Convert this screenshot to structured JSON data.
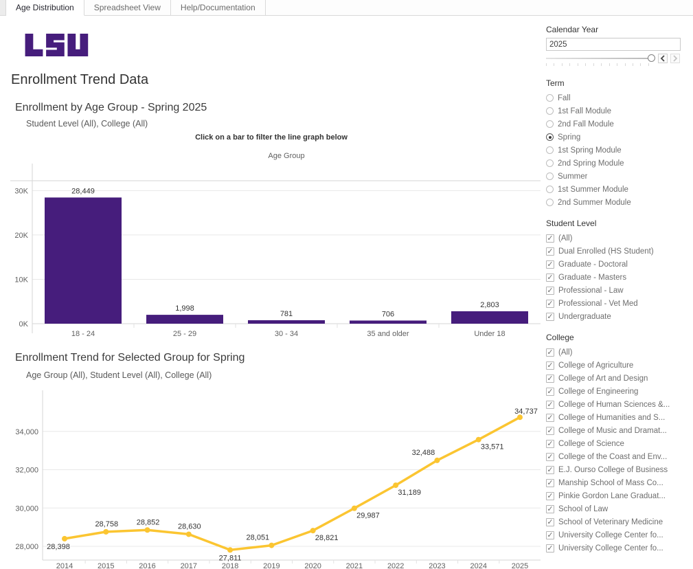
{
  "tabs": {
    "items": [
      {
        "label": "Age Distribution",
        "active": true
      },
      {
        "label": "Spreadsheet View",
        "active": false
      },
      {
        "label": "Help/Documentation",
        "active": false
      }
    ]
  },
  "header": {
    "logo": "LSU",
    "title": "Enrollment Trend Data"
  },
  "bar_section": {
    "title": "Enrollment by Age Group - Spring 2025",
    "subtitle": "Student Level (All), College (All)",
    "instruction": "Click on a bar to filter the line graph below",
    "column_header": "Age Group"
  },
  "line_section": {
    "title": "Enrollment Trend for Selected Group for Spring",
    "subtitle": "Age Group (All), Student Level (All), College (All)"
  },
  "colors": {
    "purple": "#461D7C",
    "gold": "#FBC531",
    "grid": "#e8e8e8",
    "axis": "#d6d6d6"
  },
  "chart_data": [
    {
      "type": "bar",
      "title": "Enrollment by Age Group - Spring 2025",
      "xlabel": "Age Group",
      "categories": [
        "18 - 24",
        "25 - 29",
        "30 - 34",
        "35 and older",
        "Under 18"
      ],
      "values": [
        28449,
        1998,
        781,
        706,
        2803
      ],
      "value_labels": [
        "28,449",
        "1,998",
        "781",
        "706",
        "2,803"
      ],
      "yticks": [
        0,
        10000,
        20000,
        30000
      ],
      "ytick_labels": [
        "0K",
        "10K",
        "20K",
        "30K"
      ],
      "ylim": [
        0,
        32230
      ],
      "grid": true,
      "bar_color": "#461D7C"
    },
    {
      "type": "line",
      "title": "Enrollment Trend for Selected Group for Spring",
      "x": [
        2014,
        2015,
        2016,
        2017,
        2018,
        2019,
        2020,
        2021,
        2022,
        2023,
        2024,
        2025
      ],
      "values": [
        28398,
        28758,
        28852,
        28630,
        27811,
        28051,
        28821,
        29987,
        31189,
        32488,
        33571,
        34737
      ],
      "value_labels": [
        "28,398",
        "28,758",
        "28,852",
        "28,630",
        "27,811",
        "28,051",
        "28,821",
        "29,987",
        "31,189",
        "32,488",
        "33,571",
        "34,737"
      ],
      "yticks": [
        28000,
        30000,
        32000,
        34000
      ],
      "ytick_labels": [
        "28,000",
        "30,000",
        "32,000",
        "34,000"
      ],
      "ylim": [
        27280,
        35320
      ],
      "grid": true,
      "line_color": "#FBC531",
      "label_placement": [
        "below-left",
        "above",
        "above",
        "above",
        "below",
        "above-left",
        "below-right",
        "below-right",
        "below-right",
        "above-left",
        "below-right",
        "above-right"
      ]
    }
  ],
  "filters": {
    "calendar_year": {
      "label": "Calendar Year",
      "value": "2025"
    },
    "term": {
      "label": "Term",
      "selected": "Spring",
      "options": [
        "Fall",
        "1st Fall Module",
        "2nd Fall Module",
        "Spring",
        "1st Spring Module",
        "2nd Spring Module",
        "Summer",
        "1st Summer Module",
        "2nd Summer Module"
      ]
    },
    "student_level": {
      "label": "Student Level",
      "options": [
        {
          "label": "(All)",
          "checked": true
        },
        {
          "label": "Dual Enrolled (HS Student)",
          "checked": true
        },
        {
          "label": "Graduate - Doctoral",
          "checked": true
        },
        {
          "label": "Graduate - Masters",
          "checked": true
        },
        {
          "label": "Professional - Law",
          "checked": true
        },
        {
          "label": "Professional - Vet Med",
          "checked": true
        },
        {
          "label": "Undergraduate",
          "checked": true
        }
      ]
    },
    "college": {
      "label": "College",
      "options": [
        {
          "label": "(All)",
          "checked": true
        },
        {
          "label": "College of Agriculture",
          "checked": true
        },
        {
          "label": "College of Art and Design",
          "checked": true
        },
        {
          "label": "College of Engineering",
          "checked": true
        },
        {
          "label": "College of Human Sciences &...",
          "checked": true
        },
        {
          "label": "College of Humanities and S...",
          "checked": true
        },
        {
          "label": "College of Music and Dramat...",
          "checked": true
        },
        {
          "label": "College of Science",
          "checked": true
        },
        {
          "label": "College of the Coast and Env...",
          "checked": true
        },
        {
          "label": "E.J. Ourso College of Business",
          "checked": true
        },
        {
          "label": "Manship School of Mass Co...",
          "checked": true
        },
        {
          "label": "Pinkie Gordon Lane Graduat...",
          "checked": true
        },
        {
          "label": "School of Law",
          "checked": true
        },
        {
          "label": "School of Veterinary Medicine",
          "checked": true
        },
        {
          "label": "University College Center fo...",
          "checked": true
        },
        {
          "label": "University College Center fo...",
          "checked": true
        }
      ]
    }
  }
}
